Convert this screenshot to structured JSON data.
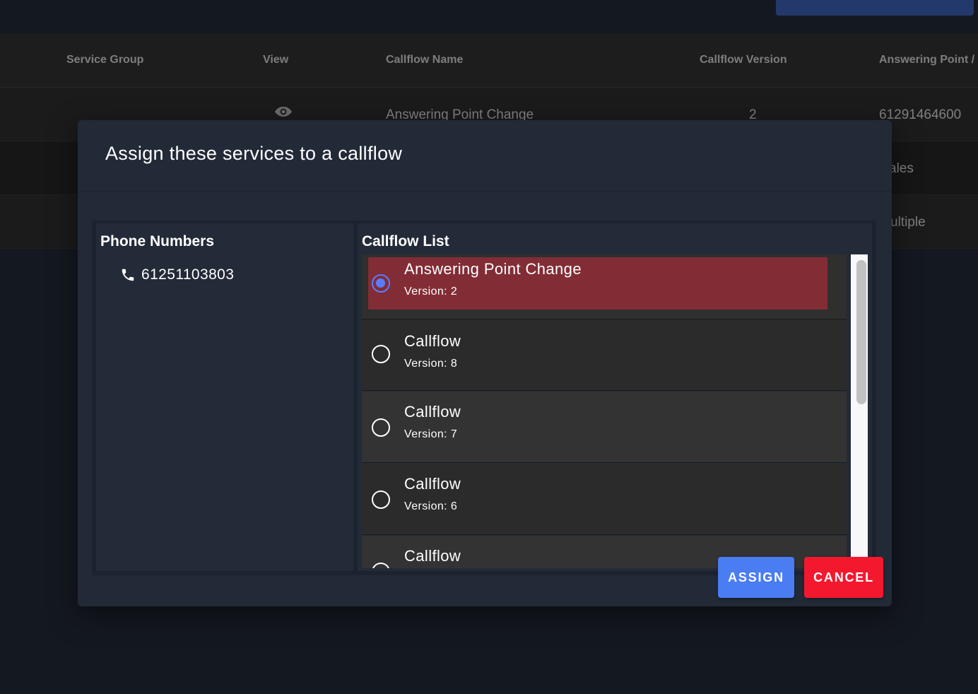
{
  "table": {
    "headers": [
      "Service Group",
      "View",
      "Callflow Name",
      "Callflow Version",
      "Answering Point /"
    ],
    "row1": {
      "callflow_name": "Answering Point Change",
      "callflow_version": "2",
      "answering_point": "61291464600"
    },
    "row2": {
      "answering_point_partial": "ales"
    },
    "row3": {
      "answering_point_partial": "ultiple"
    }
  },
  "dialog": {
    "title": "Assign these services to a callflow",
    "phone_panel": {
      "title": "Phone Numbers",
      "numbers": [
        "61251103803"
      ]
    },
    "callflow_panel": {
      "title": "Callflow List",
      "items": [
        {
          "name": "Answering Point Change",
          "version": "Version: 2",
          "selected": true
        },
        {
          "name": "Callflow",
          "version": "Version: 8",
          "selected": false
        },
        {
          "name": "Callflow",
          "version": "Version: 7",
          "selected": false
        },
        {
          "name": "Callflow",
          "version": "Version: 6",
          "selected": false
        },
        {
          "name": "Callflow",
          "version": "",
          "selected": false
        }
      ]
    },
    "buttons": {
      "assign": "ASSIGN",
      "cancel": "CANCEL"
    }
  },
  "icons": {
    "view": "eye-icon",
    "phone": "phone-icon"
  },
  "colors": {
    "selected_item": "#822d36",
    "assign": "#4a7cf2",
    "cancel": "#f4182f",
    "radio_checked": "#5b7cff"
  }
}
